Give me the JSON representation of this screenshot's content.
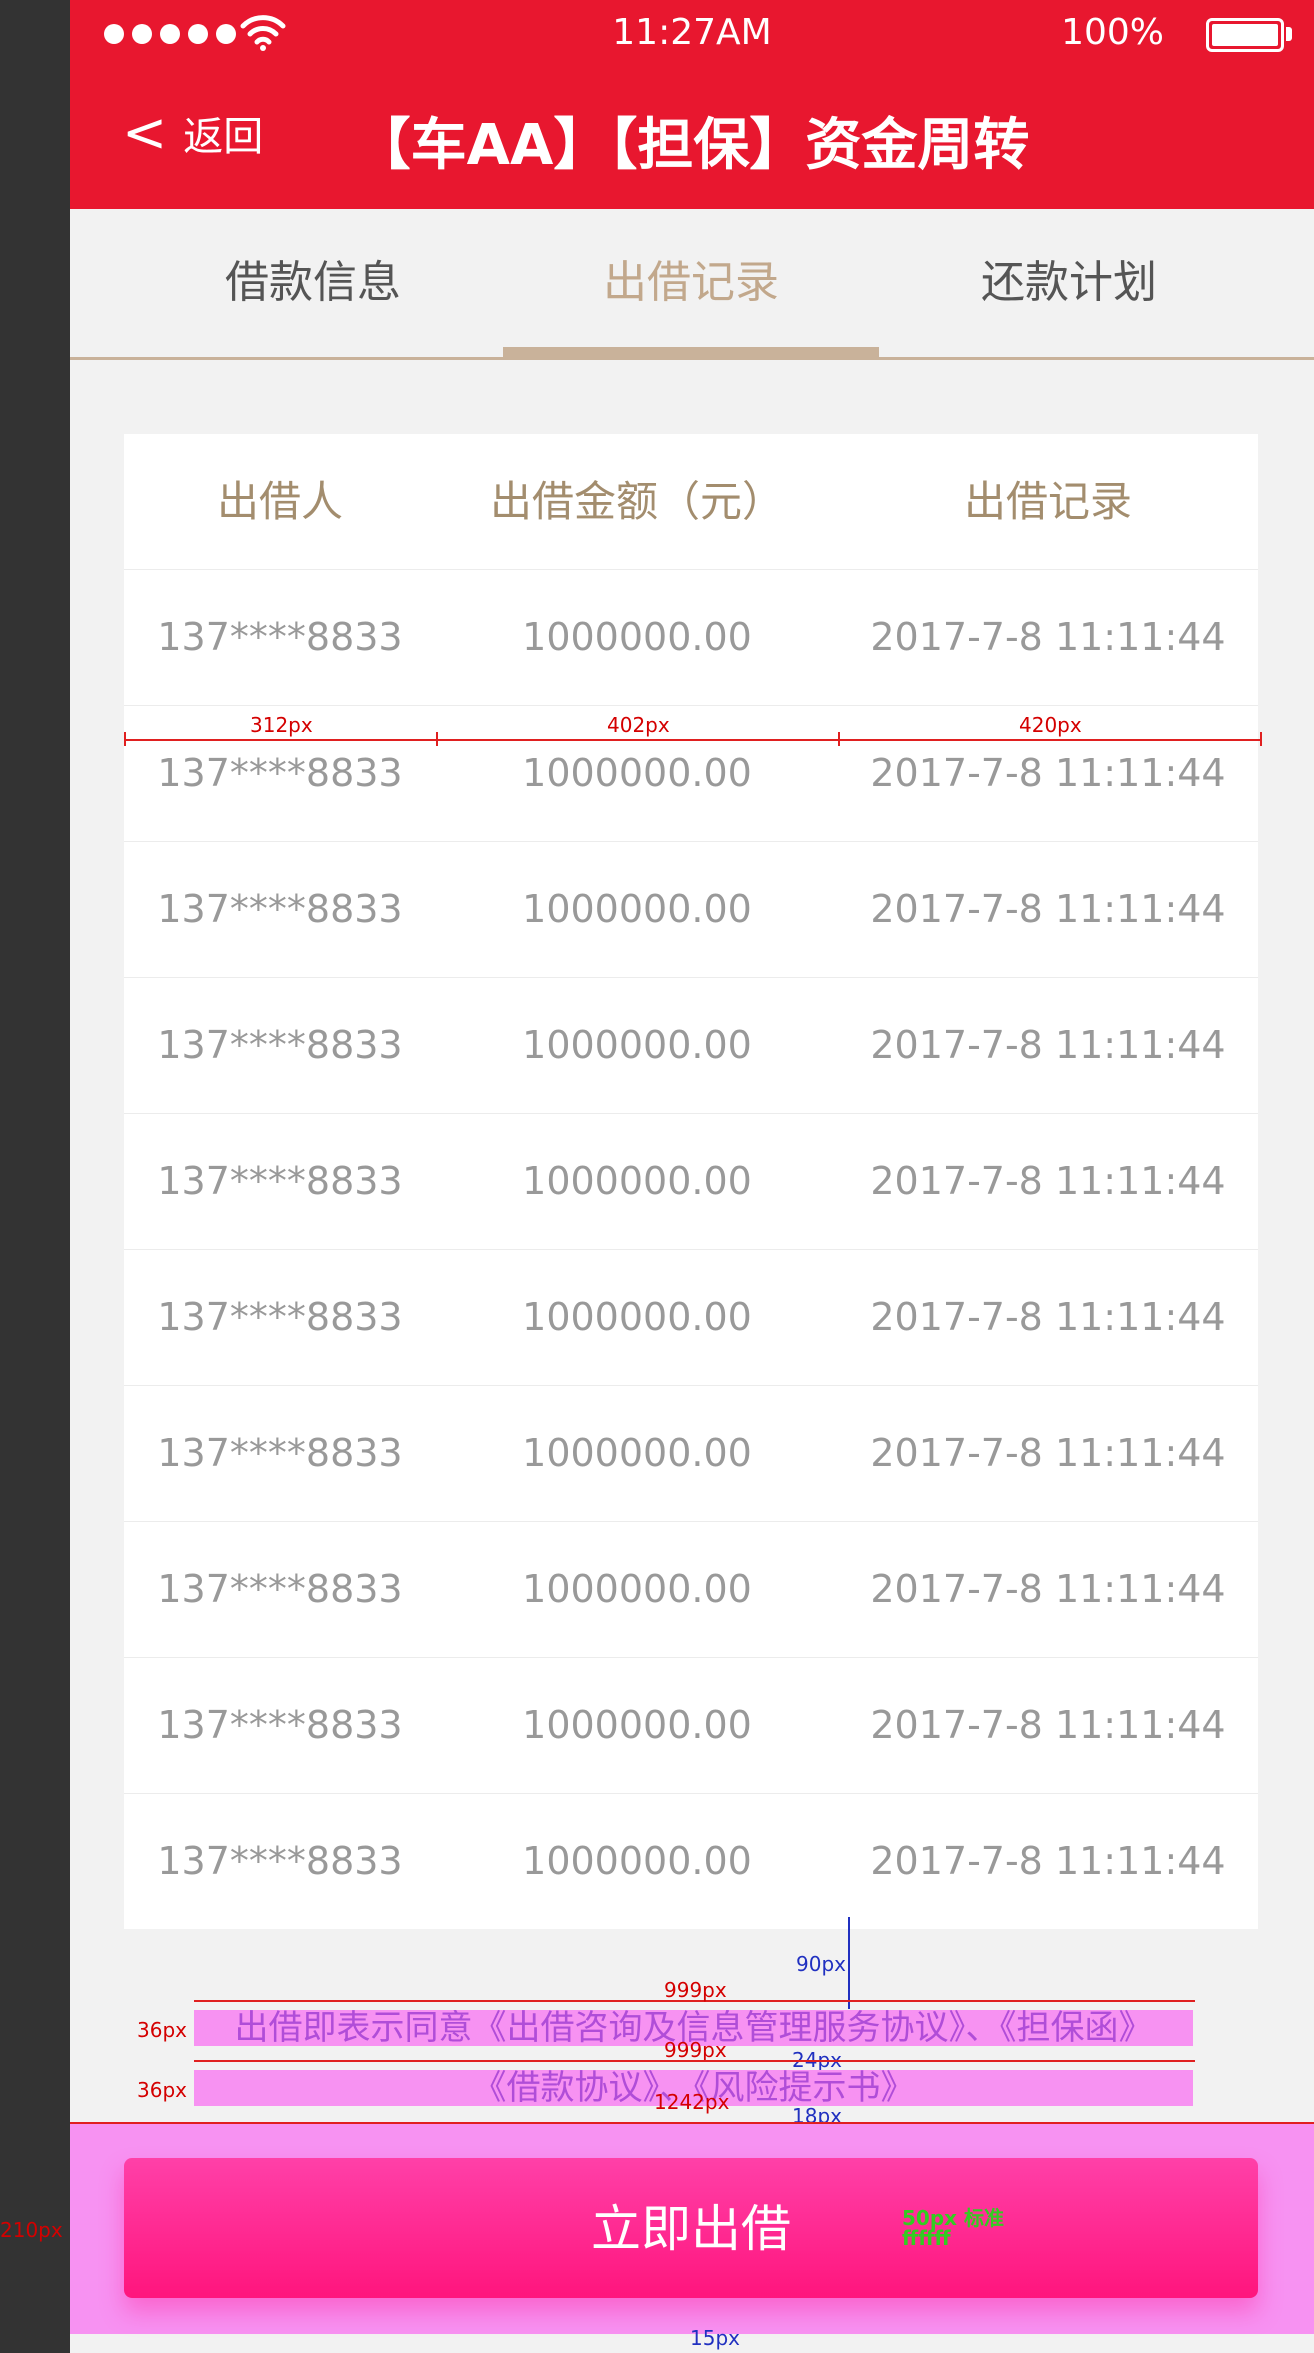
{
  "status_bar": {
    "time": "11:27AM",
    "battery": "100%"
  },
  "nav": {
    "back_label": "返回",
    "title": "【车AA】【担保】资金周转"
  },
  "tabs": [
    {
      "label": "借款信息",
      "active": false
    },
    {
      "label": "出借记录",
      "active": true
    },
    {
      "label": "还款计划",
      "active": false
    }
  ],
  "table": {
    "headers": [
      "出借人",
      "出借金额（元）",
      "出借记录"
    ],
    "rows": [
      [
        "137****8833",
        "1000000.00",
        "2017-7-8    11:11:44"
      ],
      [
        "137****8833",
        "1000000.00",
        "2017-7-8    11:11:44"
      ],
      [
        "137****8833",
        "1000000.00",
        "2017-7-8    11:11:44"
      ],
      [
        "137****8833",
        "1000000.00",
        "2017-7-8    11:11:44"
      ],
      [
        "137****8833",
        "1000000.00",
        "2017-7-8    11:11:44"
      ],
      [
        "137****8833",
        "1000000.00",
        "2017-7-8    11:11:44"
      ],
      [
        "137****8833",
        "1000000.00",
        "2017-7-8    11:11:44"
      ],
      [
        "137****8833",
        "1000000.00",
        "2017-7-8    11:11:44"
      ],
      [
        "137****8833",
        "1000000.00",
        "2017-7-8    11:11:44"
      ],
      [
        "137****8833",
        "1000000.00",
        "2017-7-8    11:11:44"
      ]
    ]
  },
  "annotations": {
    "col1": "312px",
    "col2": "402px",
    "col3": "420px",
    "gap_90": "90px",
    "w999_a": "999px",
    "w999_b": "999px",
    "h36_a": "36px",
    "h36_b": "36px",
    "gap_24": "24px",
    "w1242": "1242px",
    "gap_18": "18px",
    "h210": "210px",
    "btn_note_1": "50px 标准",
    "btn_note_2": "ffffff",
    "gap_15": "15px"
  },
  "agreement": {
    "line1": "出借即表示同意《出借咨询及信息管理服务协议》、《担保函》",
    "line2": "《借款协议》、《风险提示书》"
  },
  "footer": {
    "button_label": "立即出借"
  },
  "colors": {
    "primary": "#e8172f",
    "accent": "#c9b29a",
    "button": "#ff1a80",
    "annotation": "#f792f2"
  },
  "icons": [
    "wifi-icon",
    "battery-icon",
    "back-chevron-icon"
  ]
}
